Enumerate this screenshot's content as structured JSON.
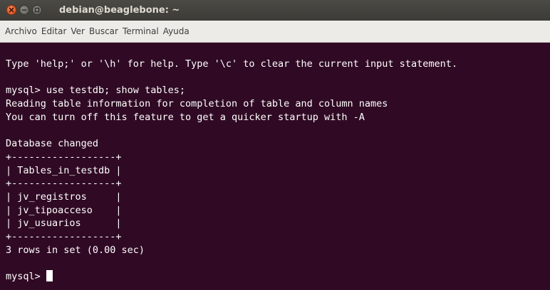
{
  "window": {
    "title": "debian@beaglebone: ~",
    "buttons": {
      "close_icon": "close-icon",
      "minimize_icon": "minimize-icon",
      "maximize_icon": "maximize-icon"
    }
  },
  "menubar": {
    "items": [
      "Archivo",
      "Editar",
      "Ver",
      "Buscar",
      "Terminal",
      "Ayuda"
    ]
  },
  "terminal": {
    "background_color": "#300a24",
    "text_color": "#ffffff",
    "lines": [
      "Type 'help;' or '\\h' for help. Type '\\c' to clear the current input statement.",
      "",
      "mysql> use testdb; show tables;",
      "Reading table information for completion of table and column names",
      "You can turn off this feature to get a quicker startup with -A",
      "",
      "Database changed",
      "+------------------+",
      "| Tables_in_testdb |",
      "+------------------+",
      "| jv_registros     |",
      "| jv_tipoacceso    |",
      "| jv_usuarios      |",
      "+------------------+",
      "3 rows in set (0.00 sec)",
      ""
    ],
    "prompt": "mysql> "
  }
}
